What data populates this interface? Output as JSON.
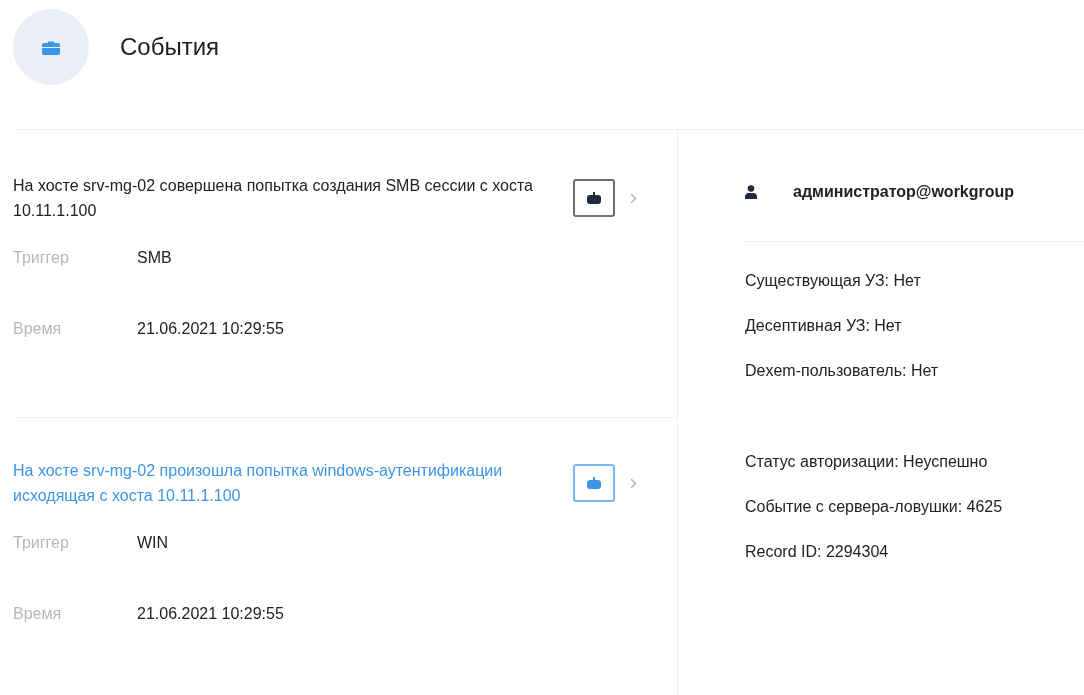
{
  "header": {
    "title": "События"
  },
  "events": [
    {
      "title": "На хосте srv-mg-02 совершена попытка создания SMB сессии с хоста 10.11.1.100",
      "selected": false,
      "fields": [
        {
          "label": "Триггер",
          "value": "SMB"
        },
        {
          "label": "Время",
          "value": "21.06.2021 10:29:55"
        }
      ]
    },
    {
      "title": "На хосте srv-mg-02 произошла попытка windows-аутентификации исходящая с хоста 10.11.1.100",
      "selected": true,
      "fields": [
        {
          "label": "Триггер",
          "value": "WIN"
        },
        {
          "label": "Время",
          "value": "21.06.2021 10:29:55"
        }
      ]
    }
  ],
  "details": {
    "user": "администратор@workgroup",
    "groups": [
      [
        "Существующая УЗ: Нет",
        "Десептивная УЗ: Нет",
        "Dexem-пользователь: Нет"
      ],
      [
        "Статус авторизации: Неуспешно",
        "Событие с сервера-ловушки: 4625",
        "Record ID: 2294304"
      ]
    ]
  }
}
